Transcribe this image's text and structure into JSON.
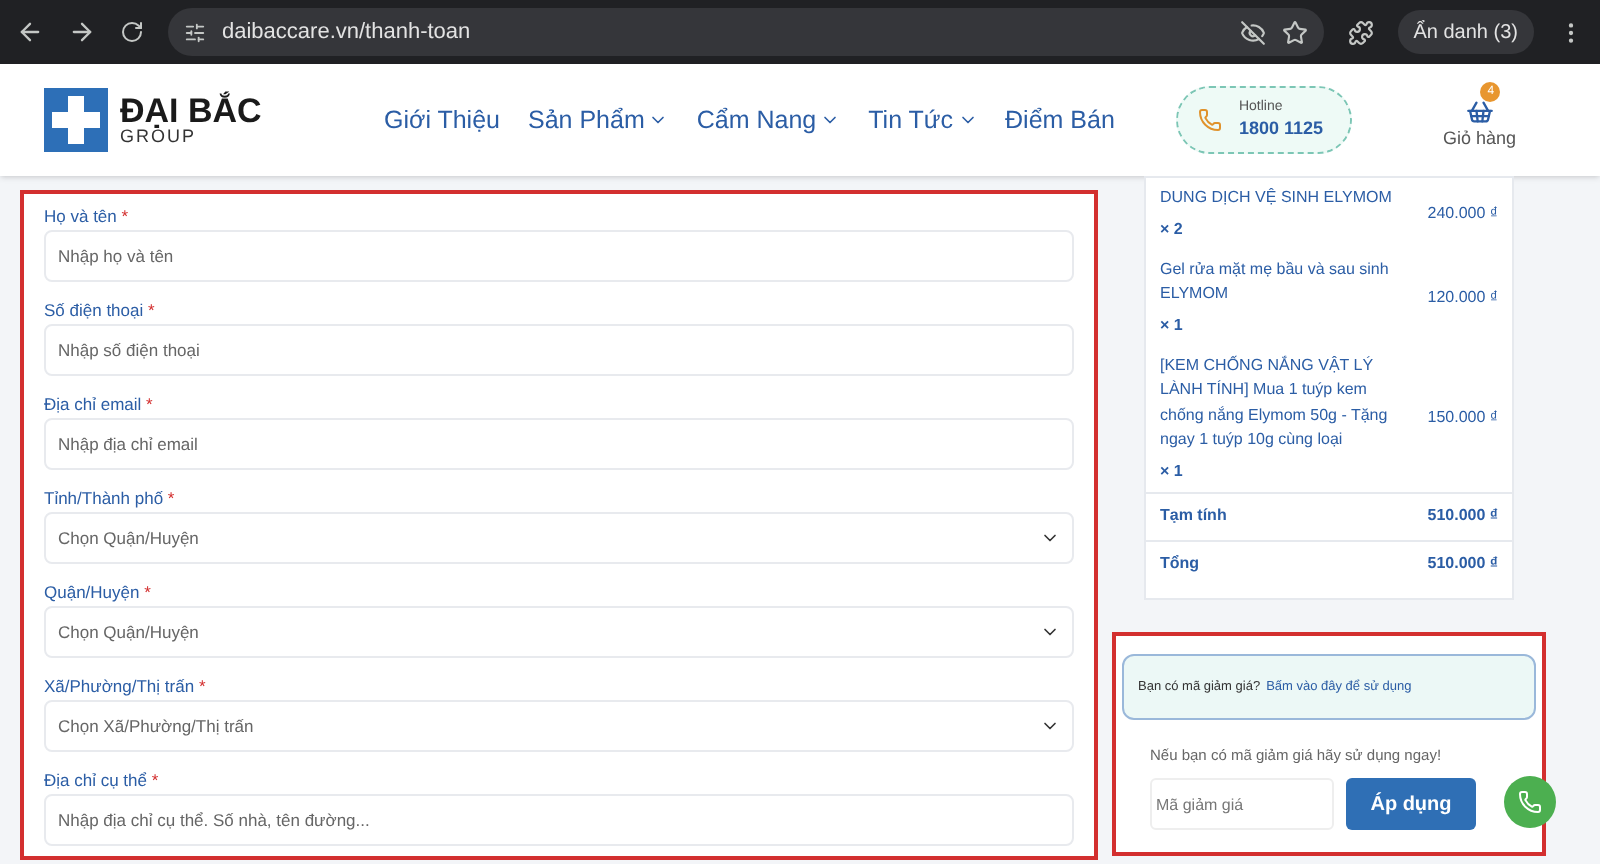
{
  "browser": {
    "url": "daibaccare.vn/thanh-toan",
    "profile": "Ẩn danh (3)"
  },
  "header": {
    "logo": {
      "name": "ĐẠI BẮC",
      "sub": "GROUP"
    },
    "nav": [
      {
        "label": "Giới Thiệu",
        "dropdown": false
      },
      {
        "label": "Sản Phẩm",
        "dropdown": true
      },
      {
        "label": "Cẩm Nang",
        "dropdown": true
      },
      {
        "label": "Tin Tức",
        "dropdown": true
      },
      {
        "label": "Điểm Bán",
        "dropdown": false
      }
    ],
    "hotline": {
      "label": "Hotline",
      "number": "1800 1125"
    },
    "cart": {
      "label": "Giỏ hàng",
      "count": "4"
    }
  },
  "form": {
    "fields": [
      {
        "kind": "input",
        "label": "Họ và tên",
        "required_mark": "*",
        "placeholder": "Nhập họ và tên"
      },
      {
        "kind": "input",
        "label": "Số điện thoại",
        "required_mark": "*",
        "placeholder": "Nhập số điện thoại"
      },
      {
        "kind": "input",
        "label": "Địa chỉ email",
        "required_mark": "*",
        "placeholder": "Nhập địa chỉ email"
      },
      {
        "kind": "select",
        "label": "Tỉnh/Thành phố",
        "required_mark": "*",
        "placeholder": "Chọn Quận/Huyện"
      },
      {
        "kind": "select",
        "label": "Quận/Huyện",
        "required_mark": "*",
        "placeholder": "Chọn Quận/Huyện"
      },
      {
        "kind": "select",
        "label": "Xã/Phường/Thị trấn",
        "required_mark": "*",
        "placeholder": "Chọn Xã/Phường/Thị trấn"
      },
      {
        "kind": "input",
        "label": "Địa chỉ cụ thể",
        "required_mark": "*",
        "placeholder": "Nhập địa chỉ cụ thể. Số nhà, tên đường..."
      }
    ]
  },
  "order": {
    "items": [
      {
        "name": "DUNG DỊCH VỆ SINH ELYMOM",
        "qty": "× 2",
        "price": "240.000 ₫"
      },
      {
        "name": "Gel rửa mặt mẹ bầu và sau sinh ELYMOM",
        "qty": "× 1",
        "price": "120.000 ₫"
      },
      {
        "name": "[KEM CHỐNG NẮNG VẬT LÝ LÀNH TÍNH] Mua 1 tuýp kem chống nắng Elymom 50g - Tặng ngay 1 tuýp 10g cùng loại",
        "qty": "× 1",
        "price": "150.000 ₫"
      }
    ],
    "totals": [
      {
        "label": "Tạm tính",
        "value": "510.000 ₫"
      },
      {
        "label": "Tổng",
        "value": "510.000 ₫"
      }
    ]
  },
  "coupon": {
    "notice": "Bạn có mã giảm giá?",
    "link": "Bấm vào đây để sử dụng",
    "hint": "Nếu bạn có mã giảm giá hãy sử dụng ngay!",
    "placeholder": "Mã giảm giá",
    "button": "Áp dụng"
  }
}
